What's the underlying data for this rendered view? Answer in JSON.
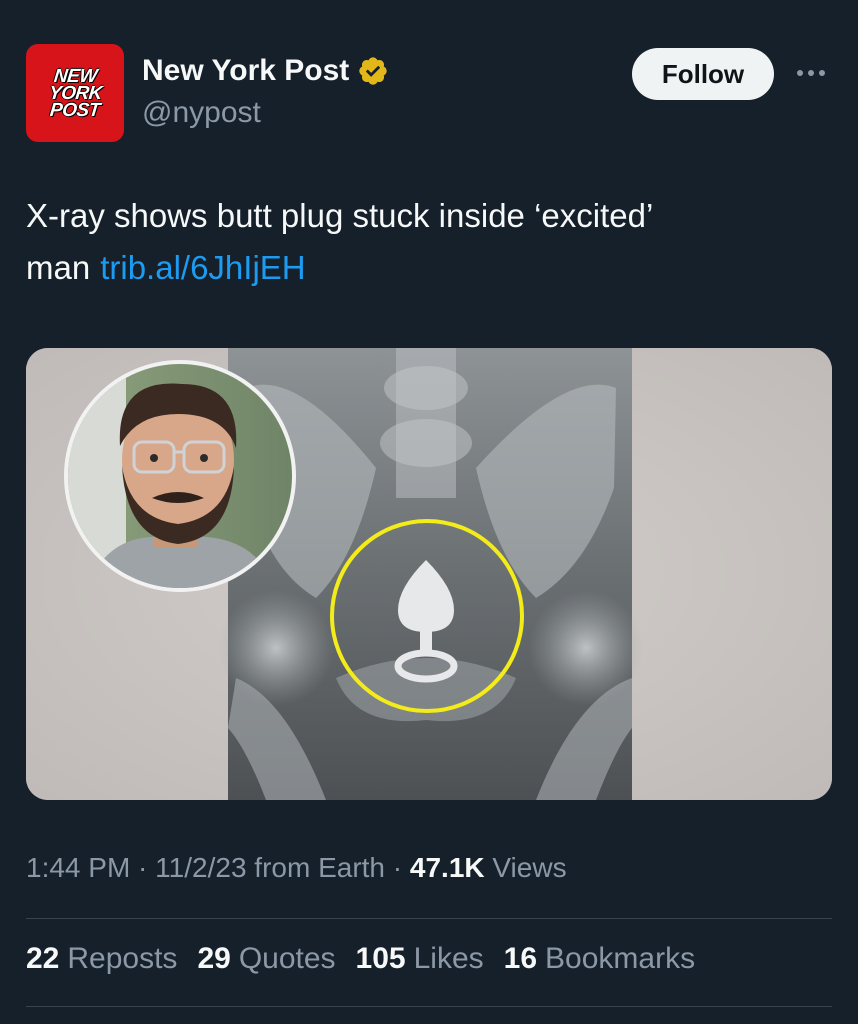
{
  "header": {
    "logo_lines": [
      "NEW",
      "YORK",
      "POST"
    ],
    "display_name": "New York Post",
    "handle": "@nypost",
    "follow_label": "Follow",
    "verified_color": "#e2b719"
  },
  "tweet": {
    "text": "X-ray shows butt plug stuck inside ‘excited’ man",
    "link": "trib.al/6JhIjEH",
    "link_color": "#1d9bf0"
  },
  "meta": {
    "time": "1:44 PM",
    "sep1": " · ",
    "date": "11/2/23",
    "source": " from Earth",
    "sep2": " · ",
    "views_count": "47.1K",
    "views_label": " Views"
  },
  "stats": {
    "reposts": {
      "count": "22",
      "label": "Reposts"
    },
    "quotes": {
      "count": "29",
      "label": "Quotes"
    },
    "likes": {
      "count": "105",
      "label": "Likes"
    },
    "bookmarks": {
      "count": "16",
      "label": "Bookmarks"
    }
  }
}
